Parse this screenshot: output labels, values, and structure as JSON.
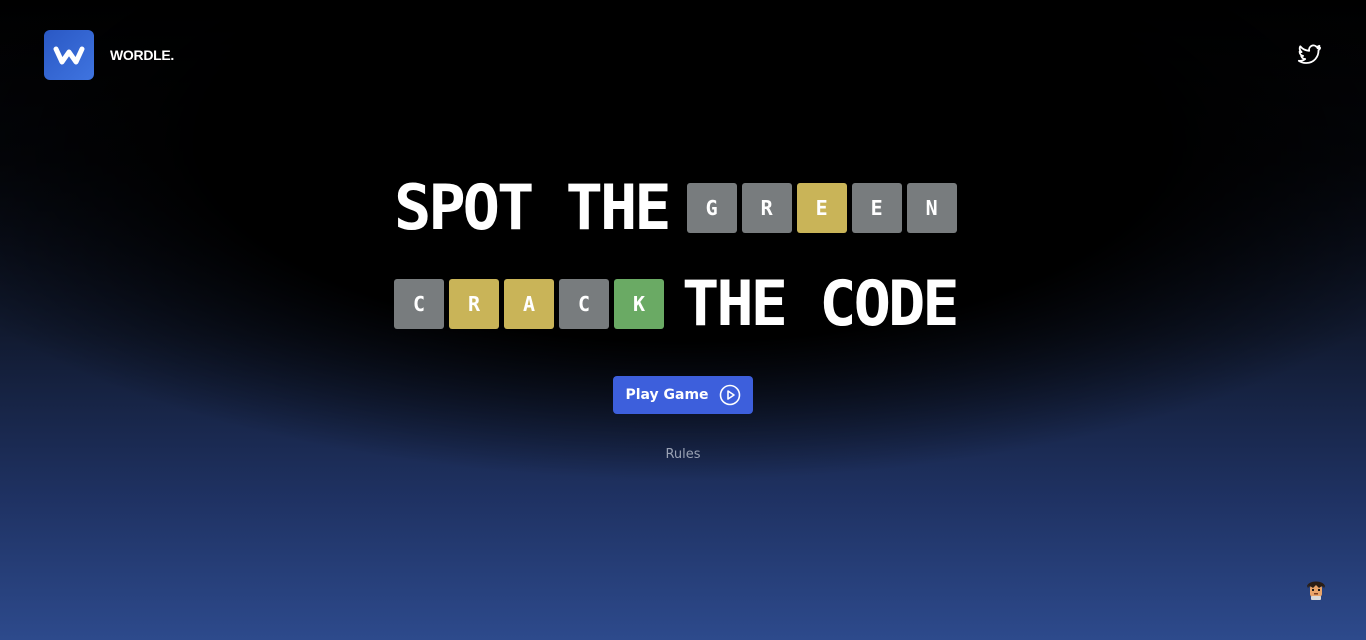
{
  "header": {
    "logo_icon": "w-logo-icon",
    "brand_name": "WORDLE.",
    "twitter_icon": "twitter-icon"
  },
  "hero": {
    "line1": {
      "text": "SPOT THE",
      "tiles": [
        {
          "letter": "G",
          "status": "absent",
          "color": "#787c7e"
        },
        {
          "letter": "R",
          "status": "absent",
          "color": "#787c7e"
        },
        {
          "letter": "E",
          "status": "present",
          "color": "#c9b458"
        },
        {
          "letter": "E",
          "status": "absent",
          "color": "#787c7e"
        },
        {
          "letter": "N",
          "status": "absent",
          "color": "#787c7e"
        }
      ]
    },
    "line2": {
      "tiles": [
        {
          "letter": "C",
          "status": "absent",
          "color": "#787c7e"
        },
        {
          "letter": "R",
          "status": "present",
          "color": "#c9b458"
        },
        {
          "letter": "A",
          "status": "present",
          "color": "#c9b458"
        },
        {
          "letter": "C",
          "status": "absent",
          "color": "#787c7e"
        },
        {
          "letter": "K",
          "status": "correct",
          "color": "#6aaa64"
        }
      ],
      "text": "THE CODE"
    }
  },
  "play_button": {
    "label": "Play Game",
    "icon": "play-circle-icon",
    "color": "#3d5fdc"
  },
  "rules_link": "Rules",
  "avatar_icon": "avatar-icon",
  "colors": {
    "absent": "#787c7e",
    "present": "#c9b458",
    "correct": "#6aaa64",
    "brand": "#2f62d4"
  }
}
